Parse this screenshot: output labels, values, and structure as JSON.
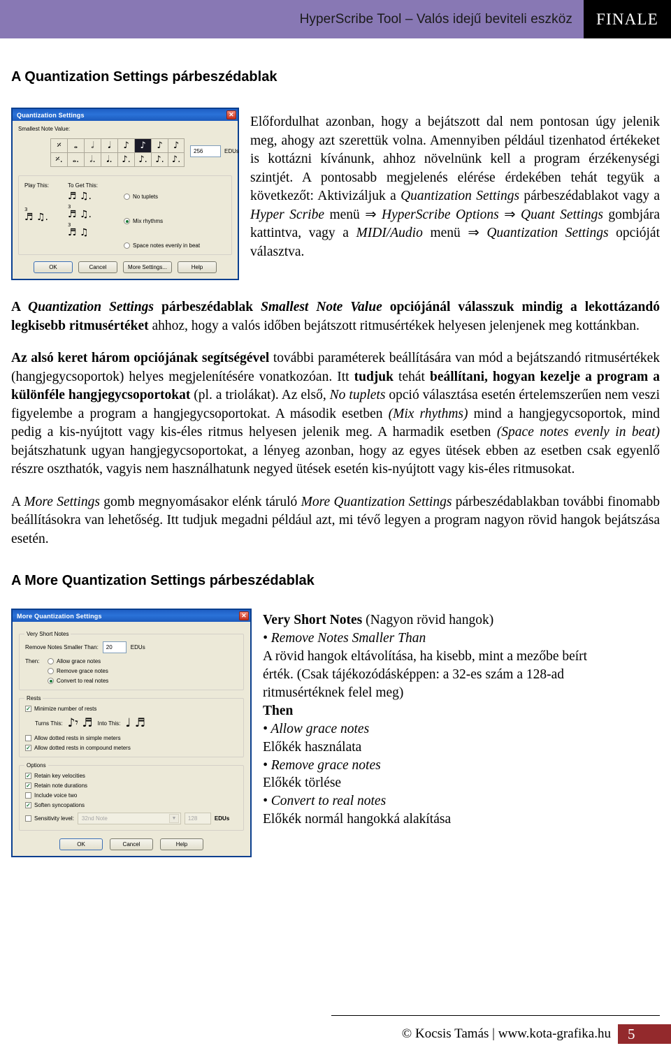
{
  "header": {
    "title": "HyperScribe Tool – Valós idejű beviteli eszköz",
    "brand": "FINALE"
  },
  "sections": {
    "quant_title": "A Quantization Settings párbeszédablak",
    "more_quant_title": "A More Quantization Settings párbeszédablak"
  },
  "quant_dialog": {
    "title": "Quantization Settings",
    "close_icon": "✕",
    "smallest_note_label": "Smallest Note Value:",
    "note_row_1": [
      "𝄺",
      "𝅝",
      "𝅗𝅥",
      "𝅘𝅥",
      "♪",
      "♪",
      "♫",
      "♫"
    ],
    "note_row_2": [
      "𝄺.",
      "𝅝.",
      "𝅗𝅥.",
      "𝅘𝅥.",
      "♪.",
      "♪.",
      "♫.",
      "♫."
    ],
    "selected_note_index": 5,
    "edus_value": "256",
    "edus_label": "EDUs",
    "play_this_label": "Play This:",
    "to_get_this_label": "To Get This:",
    "radios": [
      {
        "label": "No tuplets",
        "selected": false
      },
      {
        "label": "Mix rhythms",
        "selected": true
      },
      {
        "label": "Space notes evenly in beat",
        "selected": false
      }
    ],
    "tuplet_number": "3",
    "buttons": [
      "OK",
      "Cancel",
      "More Settings...",
      "Help"
    ]
  },
  "more_quant_dialog": {
    "title": "More Quantization Settings",
    "close_icon": "✕",
    "very_short_notes": {
      "group_label": "Very Short Notes",
      "remove_label": "Remove Notes Smaller Than:",
      "remove_value": "20",
      "edus_label": "EDUs",
      "then_label": "Then:",
      "radios": [
        {
          "label": "Allow grace notes",
          "selected": false
        },
        {
          "label": "Remove grace notes",
          "selected": false
        },
        {
          "label": "Convert to real notes",
          "selected": true
        }
      ]
    },
    "rests": {
      "group_label": "Rests",
      "minimize": {
        "label": "Minimize number of rests",
        "checked": true
      },
      "turns_this_label": "Turns This:",
      "into_this_label": "Into This:",
      "simple": {
        "label": "Allow dotted rests in simple meters",
        "checked": false
      },
      "compound": {
        "label": "Allow dotted rests in compound meters",
        "checked": true
      }
    },
    "options": {
      "group_label": "Options",
      "items": [
        {
          "label": "Retain key velocities",
          "checked": true,
          "disabled": false
        },
        {
          "label": "Retain note durations",
          "checked": true,
          "disabled": false
        },
        {
          "label": "Include voice two",
          "checked": false,
          "disabled": false
        },
        {
          "label": "Soften syncopations",
          "checked": true,
          "disabled": false
        },
        {
          "label": "Sensitivity level:",
          "checked": false,
          "disabled": true
        }
      ],
      "sensitivity_select": "32nd Note",
      "sensitivity_value": "128",
      "sensitivity_edus": "EDUs",
      "dropdown_icon": "▼"
    },
    "buttons": [
      "OK",
      "Cancel",
      "Help"
    ]
  },
  "paragraphs": {
    "intro": {
      "p1": "Előfordulhat azonban, hogy a bejátszott dal nem pontosan úgy jelenik meg, ahogy azt szerettük volna. Amennyiben például tizenhatod értékeket is kottázni kívánunk, ahhoz növelnünk kell a program érzékenységi szintjét. A pontosabb megjelenés elérése érdekében tehát tegyük a következőt: Aktivizáljuk a ",
      "i1": "Quantization Settings",
      "p2": " párbeszédablakot vagy a ",
      "i2": "Hyper Scribe",
      "p3": " menü ⇒ ",
      "i3": "HyperScribe Options",
      "p4": " ⇒ ",
      "i4": "Quant Settings",
      "p5": " gombjára kattintva, vagy a ",
      "i5": "MIDI/Audio",
      "p6": " menü ⇒ ",
      "i6": "Quantization Settings",
      "p7": " opcióját választva."
    },
    "smallest": {
      "b1": "A ",
      "bi1": "Quantization Settings",
      "b2": " párbeszédablak ",
      "bi2": "Smallest Note Value",
      "b3": " opciójánál válasszuk mindig a lekottázandó legkisebb ritmusértéket",
      "n1": " ahhoz, hogy a valós időben bejátszott ritmusértékek helyesen jelenjenek meg kottánkban."
    },
    "lower_frame": {
      "b1": "Az alsó keret három opciójának segítségével",
      "n1": " további paraméterek beállítására van mód a bejátszandó ritmusértékek (hangjegycsoportok) helyes megjelenítésére vonatkozóan. Itt ",
      "b2": "tudjuk",
      "n2": " tehát ",
      "b3": "beállítani, hogyan kezelje a program a különféle hangjegycsoportokat",
      "n3": " (pl. a triolákat). Az első, ",
      "i1": "No tuplets",
      "n4": " opció választása esetén értelemszerűen nem veszi figyelembe a program a hangjegycsoportokat. A második esetben ",
      "i2": "(Mix rhythms)",
      "n5": " mind a hangjegycsoportok, mind pedig a kis-nyújtott vagy kis-éles ritmus helyesen jelenik meg. A harmadik esetben ",
      "i3": "(Space notes evenly in beat)",
      "n6": " bejátszhatunk ugyan hangjegycsoportokat, a lényeg azonban, hogy az egyes ütések ebben az esetben csak egyenlő részre oszthatók, vagyis nem használhatunk negyed ütések esetén kis-nyújtott vagy kis-éles ritmusokat."
    },
    "more_settings": {
      "n1": "A ",
      "i1": "More Settings",
      "n2": " gomb megnyomásakor elénk táruló ",
      "i2": "More Quantization Settings",
      "n3": " párbeszédablakban további finomabb beállításokra van lehetőség. Itt tudjuk megadni például azt, mi tévő legyen a program nagyon rövid hangok bejátszása esetén."
    }
  },
  "reference_list": {
    "line1_b": "Very Short Notes",
    "line1_n": " (Nagyon rövid hangok)",
    "line2": "• Remove Notes Smaller Than",
    "line3": "A rövid hangok eltávolítása, ha kisebb, mint a mezőbe beírt",
    "line4": "érték. (Csak tájékozódásképpen: a 32-es szám a 128-ad",
    "line5": "ritmusértéknek felel meg)",
    "line6_b": "Then",
    "line7": "• Allow grace notes",
    "line8": "Előkék használata",
    "line9": "• Remove grace notes",
    "line10": "Előkék törlése",
    "line11": "• Convert to real notes",
    "line12": "Előkék normál hangokká alakítása"
  },
  "footer": {
    "credit": "© Kocsis Tamás | www.kota-grafika.hu",
    "page": "5",
    "accent_color": "#93292c",
    "header_color": "#8878b4"
  }
}
